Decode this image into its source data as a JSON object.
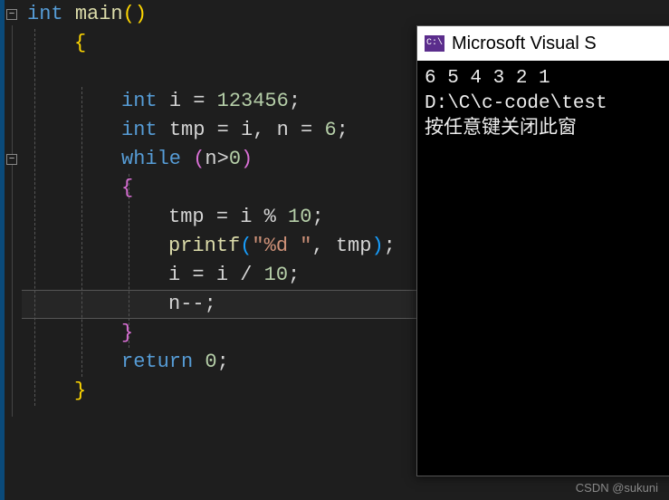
{
  "code": {
    "lines": [
      [
        {
          "cls": "kw",
          "t": "int"
        },
        {
          "cls": "pn",
          "t": " "
        },
        {
          "cls": "fn",
          "t": "main"
        },
        {
          "cls": "paren-yellow",
          "t": "()"
        }
      ],
      [
        {
          "cls": "paren-yellow",
          "t": "{"
        }
      ],
      [],
      [
        {
          "cls": "kw",
          "t": "int"
        },
        {
          "cls": "pn",
          "t": " "
        },
        {
          "cls": "ident",
          "t": "i"
        },
        {
          "cls": "pn",
          "t": " "
        },
        {
          "cls": "op",
          "t": "="
        },
        {
          "cls": "pn",
          "t": " "
        },
        {
          "cls": "num",
          "t": "123456"
        },
        {
          "cls": "pn",
          "t": ";"
        }
      ],
      [
        {
          "cls": "kw",
          "t": "int"
        },
        {
          "cls": "pn",
          "t": " "
        },
        {
          "cls": "ident",
          "t": "tmp"
        },
        {
          "cls": "pn",
          "t": " "
        },
        {
          "cls": "op",
          "t": "="
        },
        {
          "cls": "pn",
          "t": " "
        },
        {
          "cls": "ident",
          "t": "i"
        },
        {
          "cls": "pn",
          "t": ", "
        },
        {
          "cls": "ident",
          "t": "n"
        },
        {
          "cls": "pn",
          "t": " "
        },
        {
          "cls": "op",
          "t": "="
        },
        {
          "cls": "pn",
          "t": " "
        },
        {
          "cls": "num",
          "t": "6"
        },
        {
          "cls": "pn",
          "t": ";"
        }
      ],
      [
        {
          "cls": "kw",
          "t": "while"
        },
        {
          "cls": "pn",
          "t": " "
        },
        {
          "cls": "paren-pink",
          "t": "("
        },
        {
          "cls": "ident",
          "t": "n"
        },
        {
          "cls": "op",
          "t": ">"
        },
        {
          "cls": "num",
          "t": "0"
        },
        {
          "cls": "paren-pink",
          "t": ")"
        }
      ],
      [
        {
          "cls": "paren-pink",
          "t": "{"
        }
      ],
      [
        {
          "cls": "ident",
          "t": "tmp"
        },
        {
          "cls": "pn",
          "t": " "
        },
        {
          "cls": "op",
          "t": "="
        },
        {
          "cls": "pn",
          "t": " "
        },
        {
          "cls": "ident",
          "t": "i"
        },
        {
          "cls": "pn",
          "t": " "
        },
        {
          "cls": "op",
          "t": "%"
        },
        {
          "cls": "pn",
          "t": " "
        },
        {
          "cls": "num",
          "t": "10"
        },
        {
          "cls": "pn",
          "t": ";"
        }
      ],
      [
        {
          "cls": "fn",
          "t": "printf"
        },
        {
          "cls": "paren-blue",
          "t": "("
        },
        {
          "cls": "str",
          "t": "\"%d \""
        },
        {
          "cls": "pn",
          "t": ", "
        },
        {
          "cls": "ident",
          "t": "tmp"
        },
        {
          "cls": "paren-blue",
          "t": ")"
        },
        {
          "cls": "pn",
          "t": ";"
        }
      ],
      [
        {
          "cls": "ident",
          "t": "i"
        },
        {
          "cls": "pn",
          "t": " "
        },
        {
          "cls": "op",
          "t": "="
        },
        {
          "cls": "pn",
          "t": " "
        },
        {
          "cls": "ident",
          "t": "i"
        },
        {
          "cls": "pn",
          "t": " "
        },
        {
          "cls": "op",
          "t": "/"
        },
        {
          "cls": "pn",
          "t": " "
        },
        {
          "cls": "num",
          "t": "10"
        },
        {
          "cls": "pn",
          "t": ";"
        }
      ],
      [
        {
          "cls": "ident",
          "t": "n"
        },
        {
          "cls": "op",
          "t": "--"
        },
        {
          "cls": "pn",
          "t": ";"
        }
      ],
      [
        {
          "cls": "paren-pink",
          "t": "}"
        }
      ],
      [
        {
          "cls": "kw",
          "t": "return"
        },
        {
          "cls": "pn",
          "t": " "
        },
        {
          "cls": "num",
          "t": "0"
        },
        {
          "cls": "pn",
          "t": ";"
        }
      ],
      [
        {
          "cls": "paren-yellow",
          "t": "}"
        }
      ]
    ],
    "indents": [
      0,
      1,
      1,
      2,
      2,
      2,
      2,
      3,
      3,
      3,
      3,
      2,
      2,
      1
    ],
    "fold_markers": [
      {
        "line": 0
      },
      {
        "line": 5
      }
    ],
    "highlight_line": 10
  },
  "console": {
    "title": "Microsoft Visual S",
    "icon_text": "C:\\",
    "output_line1": "6 5 4 3 2 1",
    "output_line2": "D:\\C\\c-code\\test",
    "output_line3": "按任意键关闭此窗"
  },
  "watermark": "CSDN @sukuni"
}
